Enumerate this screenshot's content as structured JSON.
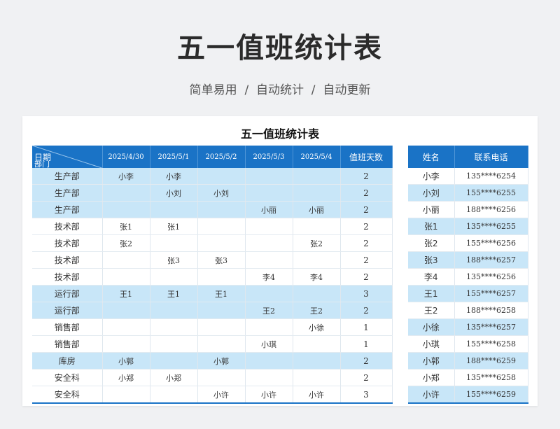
{
  "header": {
    "title": "五一值班统计表",
    "subtitle": "简单易用  /  自动统计  /  自动更新"
  },
  "sheet": {
    "title": "五一值班统计表",
    "corner_top": "日期",
    "corner_bottom": "部门",
    "dates": [
      "2025/4/30",
      "2025/5/1",
      "2025/5/2",
      "2025/5/3",
      "2025/5/4"
    ],
    "count_header": "值班天数",
    "rows": [
      {
        "dept": "生产部",
        "cells": [
          "小李",
          "小李",
          "",
          "",
          ""
        ],
        "count": "2"
      },
      {
        "dept": "生产部",
        "cells": [
          "",
          "小刘",
          "小刘",
          "",
          ""
        ],
        "count": "2"
      },
      {
        "dept": "生产部",
        "cells": [
          "",
          "",
          "",
          "小丽",
          "小丽"
        ],
        "count": "2"
      },
      {
        "dept": "技术部",
        "cells": [
          "张1",
          "张1",
          "",
          "",
          ""
        ],
        "count": "2"
      },
      {
        "dept": "技术部",
        "cells": [
          "张2",
          "",
          "",
          "",
          "张2"
        ],
        "count": "2"
      },
      {
        "dept": "技术部",
        "cells": [
          "",
          "张3",
          "张3",
          "",
          ""
        ],
        "count": "2"
      },
      {
        "dept": "技术部",
        "cells": [
          "",
          "",
          "",
          "李4",
          "李4"
        ],
        "count": "2"
      },
      {
        "dept": "运行部",
        "cells": [
          "王1",
          "王1",
          "王1",
          "",
          ""
        ],
        "count": "3"
      },
      {
        "dept": "运行部",
        "cells": [
          "",
          "",
          "",
          "王2",
          "王2"
        ],
        "count": "2"
      },
      {
        "dept": "销售部",
        "cells": [
          "",
          "",
          "",
          "",
          "小徐"
        ],
        "count": "1"
      },
      {
        "dept": "销售部",
        "cells": [
          "",
          "",
          "",
          "小琪",
          ""
        ],
        "count": "1"
      },
      {
        "dept": "库房",
        "cells": [
          "小郭",
          "",
          "小郭",
          "",
          ""
        ],
        "count": "2"
      },
      {
        "dept": "安全科",
        "cells": [
          "小郑",
          "小郑",
          "",
          "",
          ""
        ],
        "count": "2"
      },
      {
        "dept": "安全科",
        "cells": [
          "",
          "",
          "小许",
          "小许",
          "小许"
        ],
        "count": "3"
      }
    ],
    "highlight_rows": [
      0,
      1,
      2,
      7,
      8,
      11
    ]
  },
  "contacts": {
    "name_header": "姓名",
    "phone_header": "联系电话",
    "rows": [
      {
        "name": "小李",
        "phone": "135****6254"
      },
      {
        "name": "小刘",
        "phone": "155****6255"
      },
      {
        "name": "小丽",
        "phone": "188****6256"
      },
      {
        "name": "张1",
        "phone": "135****6255"
      },
      {
        "name": "张2",
        "phone": "155****6256"
      },
      {
        "name": "张3",
        "phone": "188****6257"
      },
      {
        "name": "李4",
        "phone": "135****6256"
      },
      {
        "name": "王1",
        "phone": "155****6257"
      },
      {
        "name": "王2",
        "phone": "188****6258"
      },
      {
        "name": "小徐",
        "phone": "135****6257"
      },
      {
        "name": "小琪",
        "phone": "155****6258"
      },
      {
        "name": "小郭",
        "phone": "188****6259"
      },
      {
        "name": "小郑",
        "phone": "135****6258"
      },
      {
        "name": "小许",
        "phone": "155****6259"
      }
    ],
    "highlight_rows": [
      1,
      3,
      5,
      7,
      9,
      11,
      13
    ]
  },
  "colors": {
    "header_blue": "#1a73c6",
    "highlight_row": "#c8e6f8",
    "page_background": "#f0f1f3"
  }
}
